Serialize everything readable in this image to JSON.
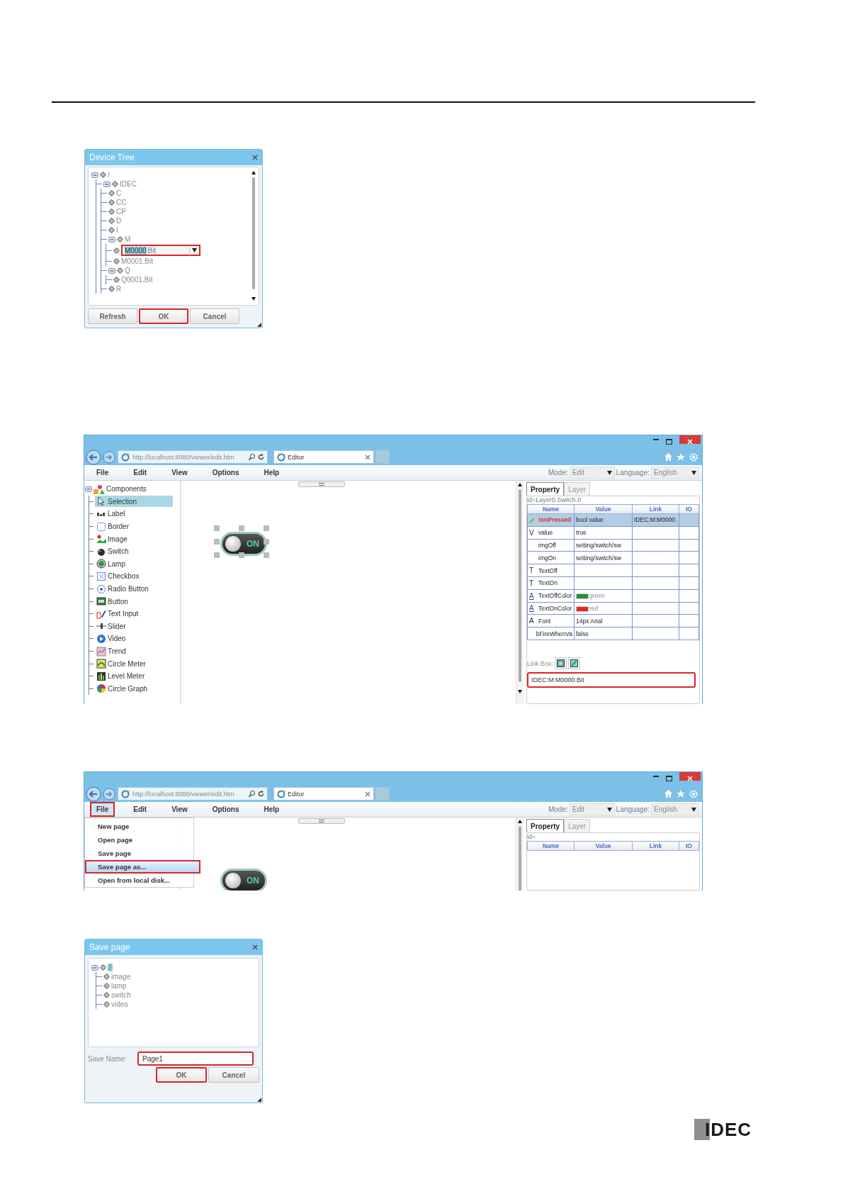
{
  "device_tree": {
    "title": "Device Tree",
    "tree": [
      {
        "label": "/",
        "expanded": true,
        "children": [
          {
            "label": "IDEC",
            "expanded": true,
            "children": [
              {
                "label": "C"
              },
              {
                "label": "CC"
              },
              {
                "label": "CP"
              },
              {
                "label": "D"
              },
              {
                "label": "I"
              },
              {
                "label": "M",
                "expanded": true,
                "children": [
                  {
                    "kind": "editor",
                    "value": "M0000",
                    "suffix": "Bit",
                    "highlighted": true
                  },
                  {
                    "kind": "node",
                    "label": "M0001.Bit"
                  }
                ]
              },
              {
                "label": "Q",
                "expanded": true,
                "children": [
                  {
                    "label": "Q0001.Bit"
                  }
                ]
              },
              {
                "label": "R"
              }
            ]
          }
        ]
      }
    ],
    "buttons": [
      {
        "label": "Refresh",
        "highlighted": false
      },
      {
        "label": "OK",
        "highlighted": true
      },
      {
        "label": "Cancel",
        "highlighted": false
      }
    ]
  },
  "editor_1": {
    "address": "http://localhost:8080/viewer/edit.htm",
    "tab": "Editor",
    "menu": [
      {
        "label": "File",
        "highlighted": false
      },
      {
        "label": "Edit",
        "highlighted": false
      },
      {
        "label": "View",
        "highlighted": false
      },
      {
        "label": "Options",
        "highlighted": false
      },
      {
        "label": "Help",
        "highlighted": false
      }
    ],
    "mode_label": "Mode:",
    "mode": "Edit",
    "language_label": "Language:",
    "language": "English",
    "components": {
      "label": "Components",
      "expanded": true,
      "items": [
        {
          "label": "Selection",
          "selected": true
        },
        {
          "label": "Label",
          "selected": false
        },
        {
          "label": "Border",
          "selected": false
        },
        {
          "label": "Image",
          "selected": false
        },
        {
          "label": "Switch",
          "selected": false
        },
        {
          "label": "Lamp",
          "selected": false
        },
        {
          "label": "Checkbox",
          "selected": false
        },
        {
          "label": "Radio Button",
          "selected": false
        },
        {
          "label": "Button",
          "selected": false
        },
        {
          "label": "Text Input",
          "selected": false
        },
        {
          "label": "Slider",
          "selected": false
        },
        {
          "label": "Video",
          "selected": false
        },
        {
          "label": "Trend",
          "selected": false
        },
        {
          "label": "Circle Meter",
          "selected": false
        },
        {
          "label": "Level Meter",
          "selected": false
        },
        {
          "label": "Circle Graph",
          "selected": false
        }
      ]
    },
    "canvas": {
      "switch": {
        "text": "ON",
        "selected": true
      }
    },
    "panel": {
      "tabs": [
        {
          "label": "Property",
          "selected": true
        },
        {
          "label": "Layer",
          "selected": false
        }
      ],
      "id": "id=Layer0.Switch.0",
      "columns": [
        "Name",
        "Value",
        "Link",
        "IO"
      ],
      "rows": [
        {
          "kind": "event",
          "name": "!onPressed",
          "value": "bool value",
          "link": "IDEC:M:M0000.",
          "selected": true
        },
        {
          "kind": "property",
          "symbol": "V",
          "name": "value",
          "value": "true",
          "selected": false
        },
        {
          "kind": "property",
          "name": "imgOff",
          "value": "setting/switch/sw",
          "selected": false
        },
        {
          "kind": "property",
          "name": "imgOn",
          "value": "setting/switch/sw",
          "selected": false
        },
        {
          "kind": "property",
          "symbol": "T",
          "name": "TextOff",
          "selected": false
        },
        {
          "kind": "property",
          "symbol": "T",
          "name": "TextOn",
          "selected": false
        },
        {
          "kind": "color",
          "symbol": "A",
          "name": "TextOffColor",
          "color": "#2a8a3a",
          "value": "green",
          "selected": false
        },
        {
          "kind": "color",
          "symbol": "A",
          "name": "TextOnColor",
          "color": "#e8262c",
          "value": "red",
          "selected": false
        },
        {
          "kind": "property",
          "symbol": "A",
          "name": "Font",
          "value": "14px Arial",
          "selected": false
        },
        {
          "kind": "property",
          "name": "bFireWhenVa",
          "value": "false",
          "selected": false
        }
      ],
      "link_box": {
        "label": "Link Box:",
        "value": "IDEC:M:M0000.Bit",
        "highlighted": true
      }
    }
  },
  "editor_2": {
    "address": "http://localhost:8080/viewer/edit.htm",
    "tab": "Editor",
    "menu": [
      {
        "label": "File",
        "highlighted": true
      },
      {
        "label": "Edit",
        "highlighted": false
      },
      {
        "label": "View",
        "highlighted": false
      },
      {
        "label": "Options",
        "highlighted": false
      },
      {
        "label": "Help",
        "highlighted": false
      }
    ],
    "mode_label": "Mode:",
    "mode": "Edit",
    "language_label": "Language:",
    "language": "English",
    "file_menu": [
      {
        "label": "New page",
        "selected": false,
        "highlighted": false
      },
      {
        "label": "Open page",
        "selected": false,
        "highlighted": false
      },
      {
        "label": "Save page",
        "selected": false,
        "highlighted": false
      },
      {
        "label": "Save page as...",
        "selected": true,
        "highlighted": true
      },
      {
        "label": "Open from local disk...",
        "selected": false,
        "highlighted": false
      }
    ],
    "canvas": {
      "switch": {
        "text": "ON",
        "selected": false
      }
    },
    "panel": {
      "tabs": [
        {
          "label": "Property",
          "selected": true
        },
        {
          "label": "Layer",
          "selected": false
        }
      ],
      "id": "id=",
      "columns": [
        "Name",
        "Value",
        "Link",
        "IO"
      ]
    }
  },
  "save_page": {
    "title": "Save page",
    "tree": [
      {
        "label": "/",
        "expanded": true,
        "selected": true,
        "children": [
          {
            "label": "image"
          },
          {
            "label": "lamp"
          },
          {
            "label": "switch"
          },
          {
            "label": "video"
          }
        ]
      }
    ],
    "name_label": "Save Name:",
    "name_value": "Page1",
    "name_highlighted": true,
    "buttons": [
      {
        "label": "OK",
        "highlighted": true
      },
      {
        "label": "Cancel",
        "highlighted": false
      }
    ]
  },
  "logo": "IDEC"
}
